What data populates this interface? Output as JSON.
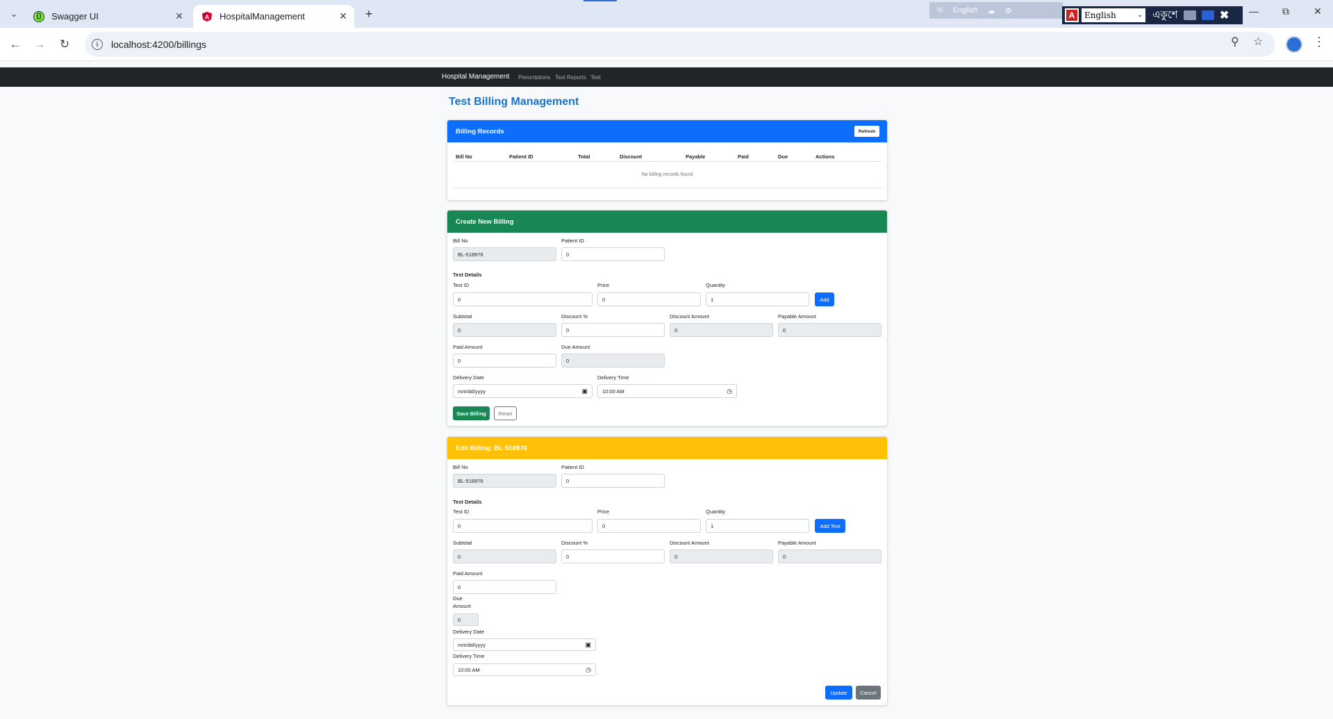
{
  "browser": {
    "tabs": [
      {
        "title": "Swagger UI"
      },
      {
        "title": "HospitalManagement"
      }
    ],
    "url": "localhost:4200/billings",
    "ime": {
      "toolbar_lang": "English",
      "selected_lang": "English",
      "bengali_label": "একুশে"
    }
  },
  "nav": {
    "brand": "Hospital Management",
    "links": [
      "Prescriptions",
      "Test Reports",
      "Test"
    ]
  },
  "page": {
    "title": "Test Billing Management"
  },
  "records": {
    "header": "Billing Records",
    "refresh_label": "Refresh",
    "columns": [
      "Bill No",
      "Patient ID",
      "Total",
      "Discount",
      "Payable",
      "Paid",
      "Due",
      "Actions"
    ],
    "empty_message": "No billing records found"
  },
  "create": {
    "header": "Create New Billing",
    "labels": {
      "bill_no": "Bill No",
      "patient_id": "Patient ID",
      "test_details": "Test Details",
      "test_id": "Test ID",
      "price": "Price",
      "quantity": "Quantity",
      "subtotal": "Subtotal",
      "discount_pct": "Discount %",
      "discount_amount": "Discount Amount",
      "payable_amount": "Payable Amount",
      "paid_amount": "Paid Amount",
      "due_amount": "Due Amount",
      "delivery_date": "Delivery Date",
      "delivery_time": "Delivery Time"
    },
    "values": {
      "bill_no": "BL-518976",
      "patient_id": "0",
      "test_id": "0",
      "price": "0",
      "quantity": "1",
      "subtotal": "0",
      "discount_pct": "0",
      "discount_amount": "0",
      "payable_amount": "0",
      "paid_amount": "0",
      "due_amount": "0",
      "delivery_date": "mm/dd/yyyy",
      "delivery_time": "10:00 AM"
    },
    "add_label": "Add",
    "save_label": "Save Billing",
    "reset_label": "Reset"
  },
  "edit": {
    "header": "Edit Billing: BL-518976",
    "labels": {
      "bill_no": "Bill No",
      "patient_id": "Patient ID",
      "test_details": "Test Details",
      "test_id": "Test ID",
      "price": "Price",
      "quantity": "Quantity",
      "subtotal": "Subtotal",
      "discount_pct": "Discount %",
      "discount_amount": "Discount Amount",
      "payable_amount": "Payable Amount",
      "paid_amount": "Paid Amount",
      "due_amount_line1": "Due",
      "due_amount_line2": "Amount",
      "delivery_date": "Delivery Date",
      "delivery_time": "Delivery Time"
    },
    "values": {
      "bill_no": "BL-518976",
      "patient_id": "0",
      "test_id": "0",
      "price": "0",
      "quantity": "1",
      "subtotal": "0",
      "discount_pct": "0",
      "discount_amount": "0",
      "payable_amount": "0",
      "paid_amount": "0",
      "due_amount": "0",
      "delivery_date": "mm/dd/yyyy",
      "delivery_time": "10:00 AM"
    },
    "add_test_label": "Add Test",
    "update_label": "Update",
    "cancel_label": "Cancel"
  },
  "colors": {
    "primary": "#0d6efd",
    "success": "#198754",
    "warning": "#ffc107",
    "secondary": "#6c757d",
    "navbar": "#212529",
    "title": "#1a73c8"
  }
}
